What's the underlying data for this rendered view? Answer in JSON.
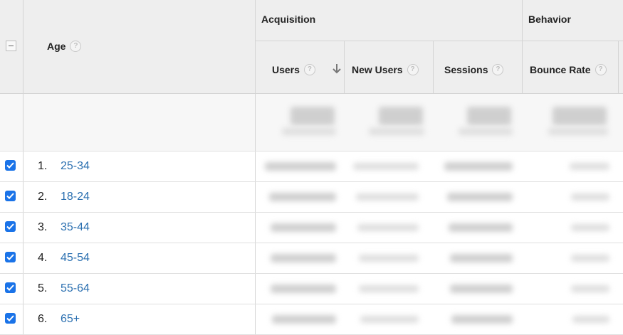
{
  "table": {
    "group_headers": {
      "acquisition": "Acquisition",
      "behavior": "Behavior"
    },
    "dimension_header": "Age",
    "columns": [
      {
        "label": "Users",
        "sorted": "descending"
      },
      {
        "label": "New Users"
      },
      {
        "label": "Sessions"
      },
      {
        "label": "Bounce Rate"
      }
    ],
    "help_glyph": "?",
    "rows": [
      {
        "index": "1.",
        "label": "25-34",
        "checked": true
      },
      {
        "index": "2.",
        "label": "18-24",
        "checked": true
      },
      {
        "index": "3.",
        "label": "35-44",
        "checked": true
      },
      {
        "index": "4.",
        "label": "45-54",
        "checked": true
      },
      {
        "index": "5.",
        "label": "55-64",
        "checked": true
      },
      {
        "index": "6.",
        "label": "65+",
        "checked": true
      }
    ],
    "metric_values_obscured": true
  },
  "colors": {
    "header_bg": "#eeeeee",
    "link": "#2a6fb0",
    "checkbox": "#1a73e8",
    "border": "#d4d4d4"
  },
  "icons": [
    "collapse-all-icon",
    "help-icon",
    "sort-descending-arrow-icon",
    "checkbox-checked-icon"
  ]
}
